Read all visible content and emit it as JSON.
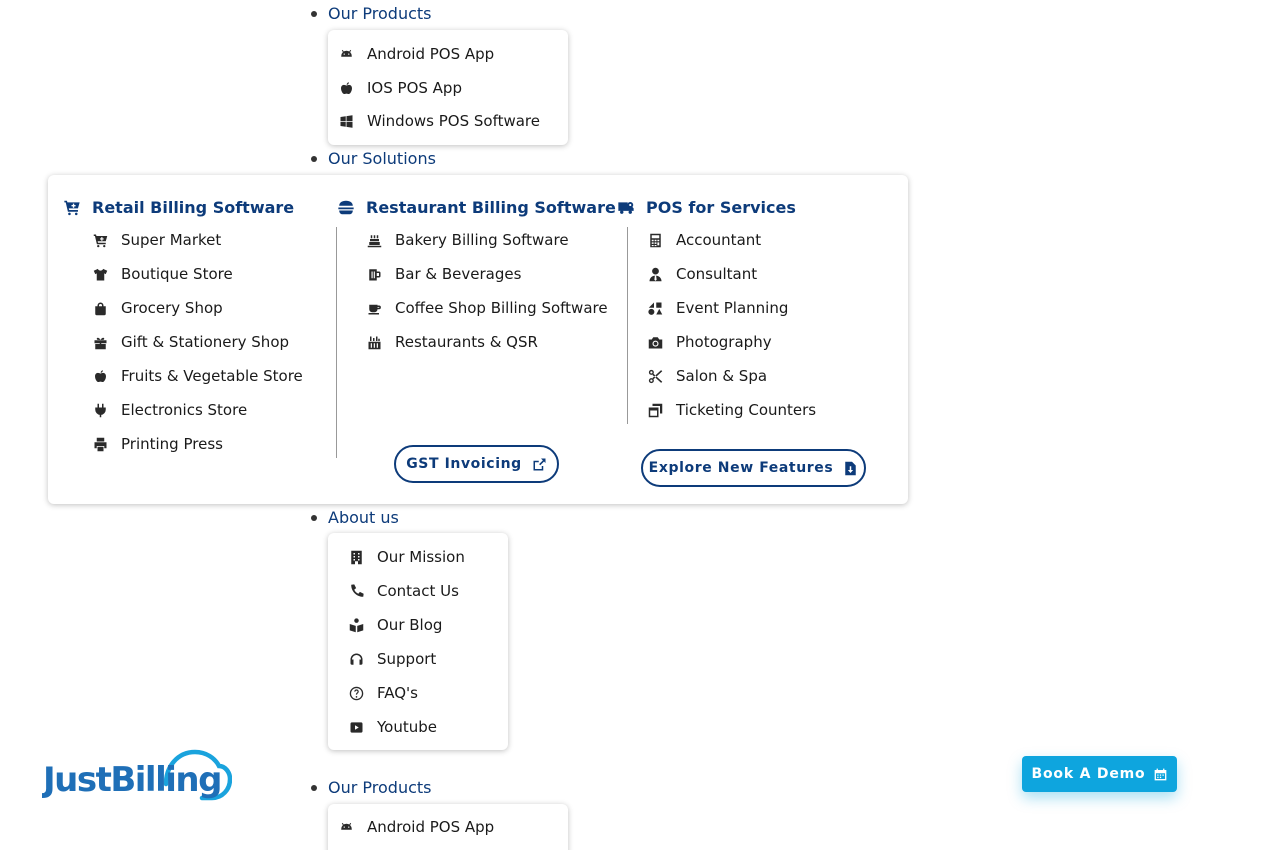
{
  "menu": {
    "products": {
      "label": "Our Products",
      "items": [
        {
          "label": "Android POS App",
          "icon": "android-icon"
        },
        {
          "label": "IOS POS App",
          "icon": "apple-icon"
        },
        {
          "label": "Windows POS Software",
          "icon": "windows-icon"
        }
      ]
    },
    "solutions": {
      "label": "Our Solutions",
      "columns": [
        {
          "heading": "Retail Billing Software",
          "icon": "cart-icon",
          "items": [
            {
              "label": "Super Market",
              "icon": "cart-icon"
            },
            {
              "label": "Boutique Store",
              "icon": "tshirt-icon"
            },
            {
              "label": "Grocery Shop",
              "icon": "shopping-bag-icon"
            },
            {
              "label": "Gift & Stationery Shop",
              "icon": "gift-icon"
            },
            {
              "label": "Fruits & Vegetable Store",
              "icon": "apple-icon"
            },
            {
              "label": "Electronics Store",
              "icon": "plug-icon"
            },
            {
              "label": "Printing Press",
              "icon": "printer-icon"
            }
          ]
        },
        {
          "heading": "Restaurant Billing Software",
          "icon": "burger-icon",
          "items": [
            {
              "label": "Bakery Billing Software",
              "icon": "cake-icon"
            },
            {
              "label": "Bar & Beverages",
              "icon": "beer-icon"
            },
            {
              "label": "Coffee Shop Billing Software",
              "icon": "coffee-icon"
            },
            {
              "label": "Restaurants & QSR",
              "icon": "kitchen-icon"
            }
          ]
        },
        {
          "heading": "POS for Services",
          "icon": "truck-gear-icon",
          "items": [
            {
              "label": "Accountant",
              "icon": "calculator-icon"
            },
            {
              "label": "Consultant",
              "icon": "user-tie-icon"
            },
            {
              "label": "Event Planning",
              "icon": "shapes-icon"
            },
            {
              "label": "Photography",
              "icon": "camera-icon"
            },
            {
              "label": "Salon & Spa",
              "icon": "scissors-icon"
            },
            {
              "label": "Ticketing Counters",
              "icon": "window-restore-icon"
            }
          ]
        }
      ],
      "gst_button": "GST Invoicing",
      "explore_button": "Explore New Features"
    },
    "about": {
      "label": "About us",
      "items": [
        {
          "label": "Our Mission",
          "icon": "building-icon"
        },
        {
          "label": "Contact Us",
          "icon": "phone-icon"
        },
        {
          "label": "Our Blog",
          "icon": "book-reader-icon"
        },
        {
          "label": "Support",
          "icon": "headset-icon"
        },
        {
          "label": "FAQ's",
          "icon": "question-circle-icon"
        },
        {
          "label": "Youtube",
          "icon": "youtube-icon"
        }
      ]
    }
  },
  "header": {
    "logo_text": "JustBilling",
    "book_demo": "Book A Demo",
    "products_label": "Our Products",
    "products_first_item": "Android POS App"
  },
  "colors": {
    "brand_navy": "#0d3b7a",
    "brand_blue": "#0ea5de",
    "logo_dark": "#1f6fb7"
  }
}
